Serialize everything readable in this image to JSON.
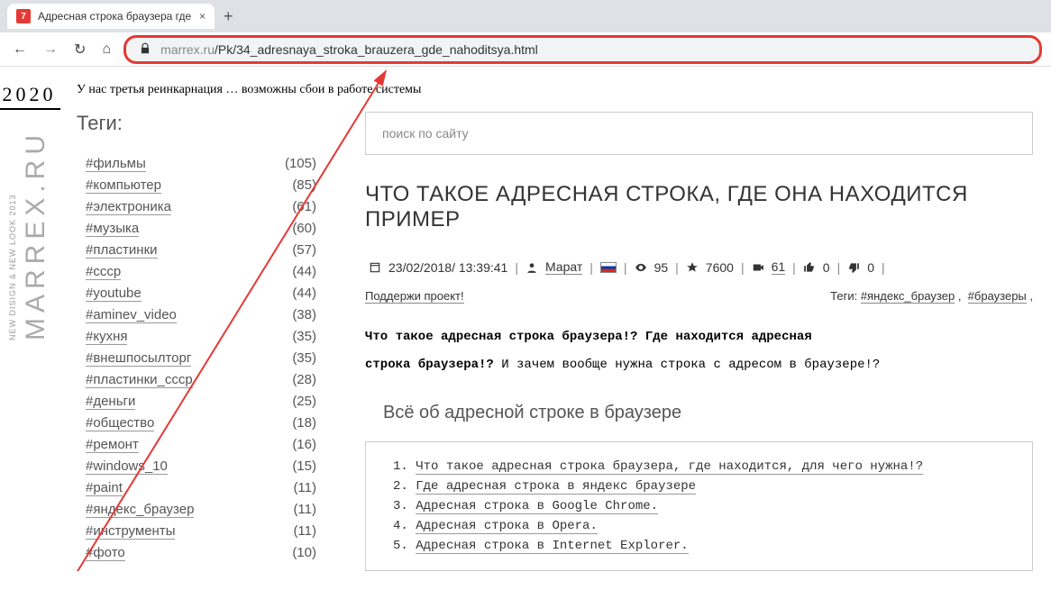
{
  "browser": {
    "tab_title": "Адресная строка браузера где",
    "favicon_char": "7",
    "url_host": "marrex.ru",
    "url_path": "/Pk/34_adresnaya_stroka_brauzera_gde_nahoditsya.html"
  },
  "left": {
    "year": "2020",
    "logo": "MARREX.RU",
    "tagline": "NEW DISIGN & NEW LOOK 2013"
  },
  "notice": "У нас третья реинкарнация … возможны сбои в работе системы",
  "sidebar": {
    "title": "Теги:",
    "items": [
      {
        "name": "#фильмы",
        "count": "(105)"
      },
      {
        "name": "#компьютер",
        "count": "(85)"
      },
      {
        "name": "#электроника",
        "count": "(61)"
      },
      {
        "name": "#музыка",
        "count": "(60)"
      },
      {
        "name": "#пластинки",
        "count": "(57)"
      },
      {
        "name": "#ссср",
        "count": "(44)"
      },
      {
        "name": "#youtube",
        "count": "(44)"
      },
      {
        "name": "#aminev_video",
        "count": "(38)"
      },
      {
        "name": "#кухня",
        "count": "(35)"
      },
      {
        "name": "#внешпосылторг",
        "count": "(35)"
      },
      {
        "name": "#пластинки_ссср",
        "count": "(28)"
      },
      {
        "name": "#деньги",
        "count": "(25)"
      },
      {
        "name": "#общество",
        "count": "(18)"
      },
      {
        "name": "#ремонт",
        "count": "(16)"
      },
      {
        "name": "#windows_10",
        "count": "(15)"
      },
      {
        "name": "#paint",
        "count": "(11)"
      },
      {
        "name": "#яндекс_браузер",
        "count": "(11)"
      },
      {
        "name": "#инструменты",
        "count": "(11)"
      },
      {
        "name": "#фото",
        "count": "(10)"
      }
    ]
  },
  "main": {
    "search_placeholder": "поиск по сайту",
    "title": "ЧТО ТАКОЕ АДРЕСНАЯ СТРОКА, ГДЕ ОНА НАХОДИТСЯ ПРИМЕР",
    "meta": {
      "date": "23/02/2018/ 13:39:41",
      "author": "Марат",
      "views": "95",
      "stars": "7600",
      "media": "61",
      "like": "0",
      "dislike": "0"
    },
    "support_label": "Поддержи проект!",
    "tags_label": "Теги:",
    "tag1": "#яндекс_браузер",
    "tag2": "#браузеры",
    "intro_bold1": "Что такое адресная строка браузера!? Где находится адресная",
    "intro_bold2": "строка браузера!?",
    "intro_rest": " И зачем вообще нужна строка с адресом в браузере!?",
    "section_title": "Всё об адресной строке в браузере",
    "toc": [
      "Что такое адресная строка браузера, где находится, для чего нужна!?",
      "Где адресная строка в яндекс браузере",
      "Адресная строка в Google Chrome.",
      "Адресная строка в Opera.",
      "Адресная строка в Internet Explorer."
    ]
  }
}
